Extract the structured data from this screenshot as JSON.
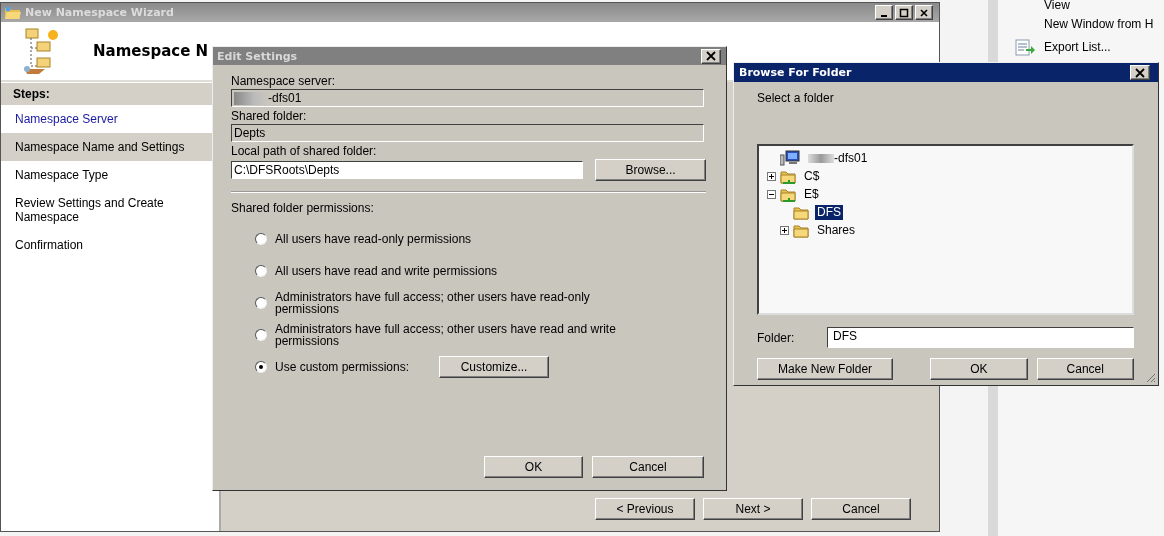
{
  "actions_pane": {
    "items": [
      {
        "label": "View",
        "kind": "plain"
      },
      {
        "label": "New Window from H",
        "kind": "plain"
      },
      {
        "label": "Export List...",
        "kind": "export"
      }
    ]
  },
  "wizard": {
    "title": "New Namespace Wizard",
    "heading": "Namespace N",
    "steps_heading": "Steps:",
    "steps": [
      {
        "label": "Namespace Server",
        "selected": false,
        "completed": true
      },
      {
        "label": "Namespace Name and Settings",
        "selected": true,
        "completed": false
      },
      {
        "label": "Namespace Type",
        "selected": false,
        "completed": false
      },
      {
        "label": "Review Settings and Create Namespace",
        "selected": false,
        "completed": false
      },
      {
        "label": "Confirmation",
        "selected": false,
        "completed": false
      }
    ],
    "buttons": [
      "< Previous",
      "Next >",
      "Cancel"
    ]
  },
  "edit_settings": {
    "title": "Edit Settings",
    "fields": [
      {
        "label": "Namespace server:",
        "value": "-dfs01",
        "redacted": true,
        "readonly": true
      },
      {
        "label": "Shared folder:",
        "value": "Depts",
        "redacted": false,
        "readonly": true
      },
      {
        "label": "Local path of shared folder:",
        "value": "C:\\DFSRoots\\Depts",
        "redacted": false,
        "readonly": false
      }
    ],
    "browse_button": "Browse...",
    "permissions_label": "Shared folder permissions:",
    "permissions": [
      {
        "label": "All users have read-only permissions",
        "selected": false
      },
      {
        "label": "All users have read and write permissions",
        "selected": false
      },
      {
        "label": "Administrators have full access; other users have read-only permissions",
        "selected": false
      },
      {
        "label": "Administrators have full access; other users have read and write permissions",
        "selected": false
      },
      {
        "label": "Use custom permissions:",
        "selected": true
      }
    ],
    "customize_button": "Customize...",
    "buttons": [
      "OK",
      "Cancel"
    ]
  },
  "browse_for_folder": {
    "title": "Browse For Folder",
    "prompt": "Select a folder",
    "tree": [
      {
        "label": "-dfs01",
        "kind": "computer",
        "redacted": true,
        "selected": false,
        "children": [
          {
            "label": "C$",
            "kind": "share",
            "expanded": false,
            "selected": false
          },
          {
            "label": "E$",
            "kind": "share",
            "expanded": true,
            "selected": false,
            "children": [
              {
                "label": "DFS",
                "kind": "folder",
                "selected": true
              },
              {
                "label": "Shares",
                "kind": "folder",
                "expanded": false,
                "selected": false
              }
            ]
          }
        ]
      }
    ],
    "folder_label": "Folder:",
    "folder_value": "DFS",
    "buttons": [
      "Make New Folder",
      "OK",
      "Cancel"
    ]
  }
}
